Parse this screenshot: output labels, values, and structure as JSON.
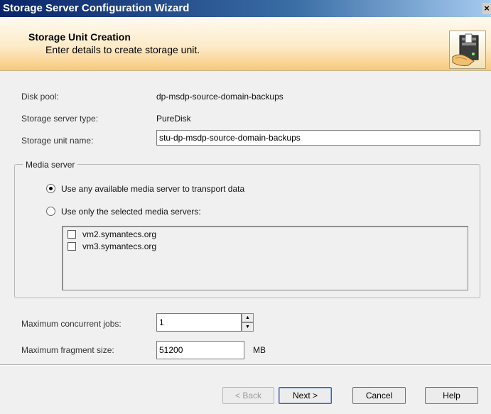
{
  "window": {
    "title": "Storage Server Configuration Wizard",
    "close_glyph": "×"
  },
  "header": {
    "title": "Storage Unit Creation",
    "subtitle": "Enter details to create storage unit.",
    "icon": "wizard-storage-icon"
  },
  "form": {
    "disk_pool_label": "Disk pool:",
    "disk_pool_value": "dp-msdp-source-domain-backups",
    "server_type_label": "Storage server type:",
    "server_type_value": "PureDisk",
    "unit_name_label": "Storage unit name:",
    "unit_name_value": "stu-dp-msdp-source-domain-backups"
  },
  "media_server": {
    "group_label": "Media server",
    "option_any": "Use any available media server to transport data",
    "option_selected": "Use only the selected media servers:",
    "selected_option": "any",
    "servers": [
      {
        "name": "vm2.symantecs.org",
        "checked": false
      },
      {
        "name": "vm3.symantecs.org",
        "checked": false
      }
    ]
  },
  "limits": {
    "max_jobs_label": "Maximum concurrent jobs:",
    "max_jobs_value": "1",
    "max_fragment_label": "Maximum fragment size:",
    "max_fragment_value": "51200",
    "fragment_unit": "MB"
  },
  "buttons": {
    "back": "< Back",
    "next": "Next >",
    "cancel": "Cancel",
    "help": "Help"
  }
}
